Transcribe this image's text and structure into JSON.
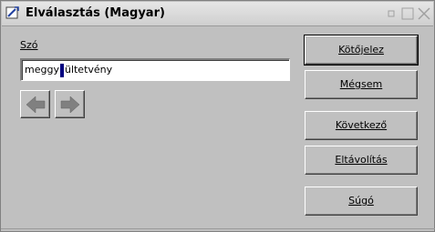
{
  "window": {
    "title": "Elválasztás (Magyar)",
    "icons": {
      "app": "hyphenation-app-icon",
      "minimize": "minimize-icon",
      "maximize": "maximize-icon",
      "close": "close-icon"
    }
  },
  "word_field": {
    "label": "Szó",
    "value_before_caret": "meggy",
    "caret_char": "",
    "value_after_caret": "ültetvény"
  },
  "navigation": {
    "prev_icon": "arrow-left-icon",
    "next_icon": "arrow-right-icon"
  },
  "buttons": {
    "hyphenate": "Kötőjelez",
    "cancel": "Mégsem",
    "next": "Következő",
    "remove": "Eltávolítás",
    "help": "Súgó"
  },
  "colors": {
    "background": "#c0c0c0",
    "caret_highlight": "#000080",
    "arrow_fill": "#808080"
  }
}
